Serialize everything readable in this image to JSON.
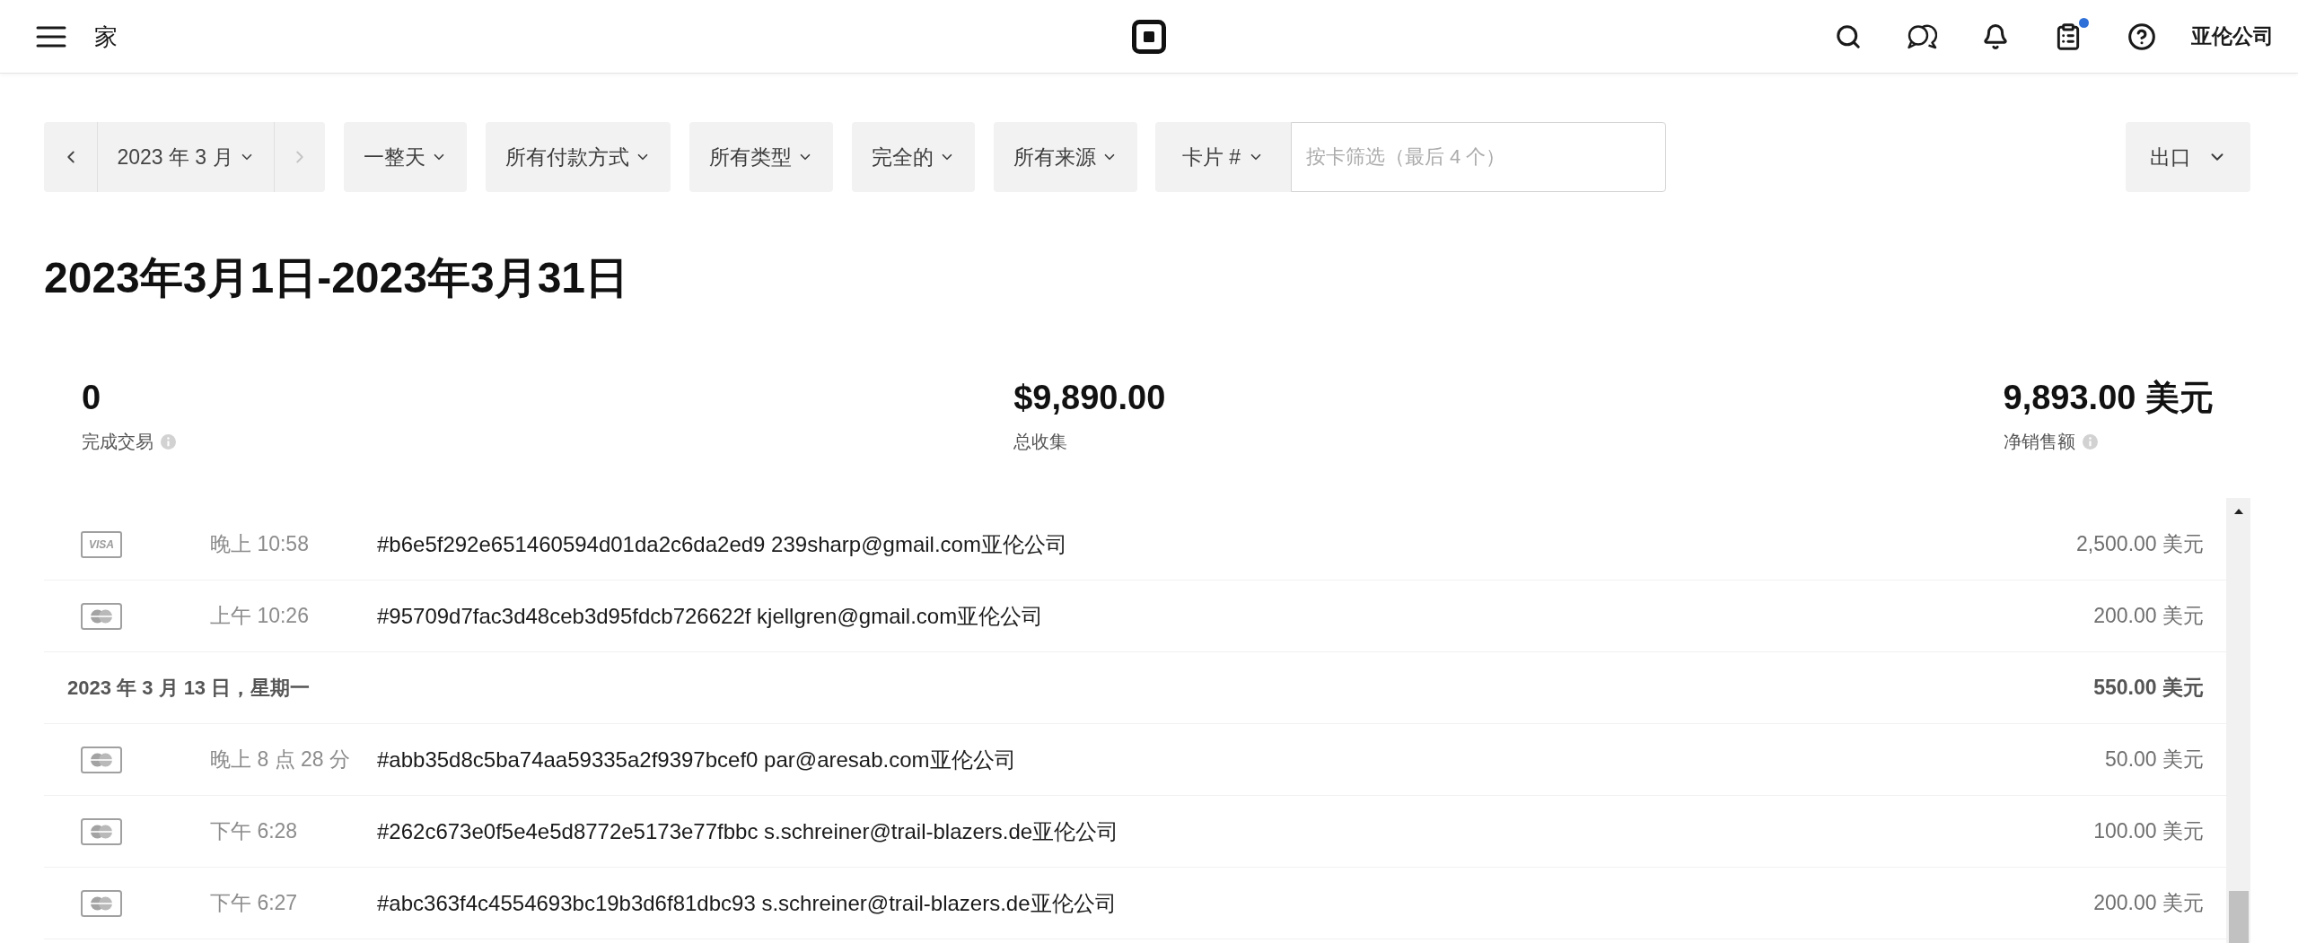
{
  "header": {
    "title": "家",
    "account": "亚伦公司",
    "clipboard_badge": true
  },
  "filters": {
    "previous_disabled": false,
    "date": "2023 年 3 月",
    "next_disabled": true,
    "dropdowns": [
      "一整天",
      "所有付款方式",
      "所有类型",
      "完全的",
      "所有来源"
    ],
    "card_filter": {
      "label": "卡片 #",
      "placeholder": "按卡筛选（最后 4 个）"
    },
    "export": "出口"
  },
  "title": "2023年3月1日-2023年3月31日",
  "stats": [
    {
      "value": "0",
      "label": "完成交易",
      "info": true
    },
    {
      "value": "$9,890.00",
      "label": "总收集",
      "info": false
    },
    {
      "value": "9,893.00 美元",
      "label": "净销售额",
      "info": true
    }
  ],
  "transactions": [
    {
      "kind": "payment",
      "card": {
        "kind": "visa",
        "label": "VISA"
      },
      "time": "晚上 10:58",
      "description": "#b6e5f292e651460594d01da2c6da2ed9 239sharp@gmail.com亚伦公司",
      "amount": "2,500.00 美元"
    },
    {
      "kind": "payment",
      "card": {
        "kind": "mastercard"
      },
      "time": "上午 10:26",
      "description": "#95709d7fac3d48ceb3d95fdcb726622f kjellgren@gmail.com亚伦公司",
      "amount": "200.00 美元"
    },
    {
      "kind": "date",
      "date": "2023 年 3 月 13 日，星期一",
      "amount": "550.00 美元"
    },
    {
      "kind": "payment",
      "card": {
        "kind": "mastercard"
      },
      "time": "晚上 8 点 28 分",
      "description": "#abb35d8c5ba74aa59335a2f9397bcef0 par@aresab.com亚伦公司",
      "amount": "50.00 美元"
    },
    {
      "kind": "payment",
      "card": {
        "kind": "mastercard"
      },
      "time": "下午 6:28",
      "description": "#262c673e0f5e4e5d8772e5173e77fbbc s.schreiner@trail-blazers.de亚伦公司",
      "amount": "100.00 美元"
    },
    {
      "kind": "payment",
      "card": {
        "kind": "mastercard"
      },
      "time": "下午 6:27",
      "description": "#abc363f4c4554693bc19b3d6f81dbc93 s.schreiner@trail-blazers.de亚伦公司",
      "amount": "200.00 美元"
    }
  ]
}
